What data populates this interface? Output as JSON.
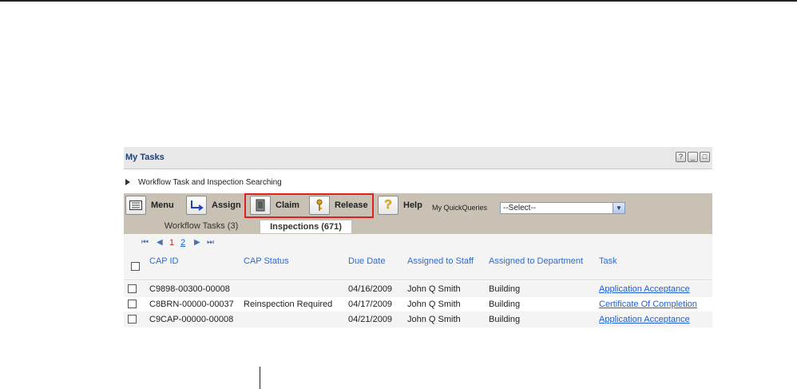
{
  "panel": {
    "title": "My Tasks",
    "window_buttons": [
      "?",
      "_",
      "□"
    ]
  },
  "search": {
    "label": "Workflow Task and Inspection Searching"
  },
  "toolbar": {
    "menu_label": "Menu",
    "assign_label": "Assign",
    "claim_label": "Claim",
    "release_label": "Release",
    "help_label": "Help",
    "quickqueries_label": "My QuickQueries",
    "quickqueries_value": "--Select--"
  },
  "tabs": [
    {
      "label": "Workflow Tasks (3)",
      "active": true
    },
    {
      "label": "Inspections (671)",
      "active": false
    }
  ],
  "pager": {
    "first": "⏮",
    "prev": "◀",
    "pages": [
      "1",
      "2"
    ],
    "current_page": "1",
    "next": "▶",
    "last": "⏭"
  },
  "table": {
    "columns": [
      "CAP ID",
      "CAP Status",
      "Due Date",
      "Assigned to Staff",
      "Assigned to Department",
      "Task"
    ],
    "rows": [
      {
        "cap_id": "C9898-00300-00008",
        "status": "",
        "due": "04/16/2009",
        "staff": "John Q Smith",
        "dept": "Building",
        "task": "Application Acceptance"
      },
      {
        "cap_id": "C8BRN-00000-00037",
        "status": "Reinspection Required",
        "due": "04/17/2009",
        "staff": "John Q Smith",
        "dept": "Building",
        "task": "Certificate Of Completion"
      },
      {
        "cap_id": "C9CAP-00000-00008",
        "status": "",
        "due": "04/21/2009",
        "staff": "John Q Smith",
        "dept": "Building",
        "task": "Application Acceptance"
      }
    ]
  },
  "colors": {
    "toolbar_bg": "#c9c1b4",
    "highlight": "#e02020",
    "link": "#1f5fd0",
    "header_text": "#2b6bd1"
  }
}
